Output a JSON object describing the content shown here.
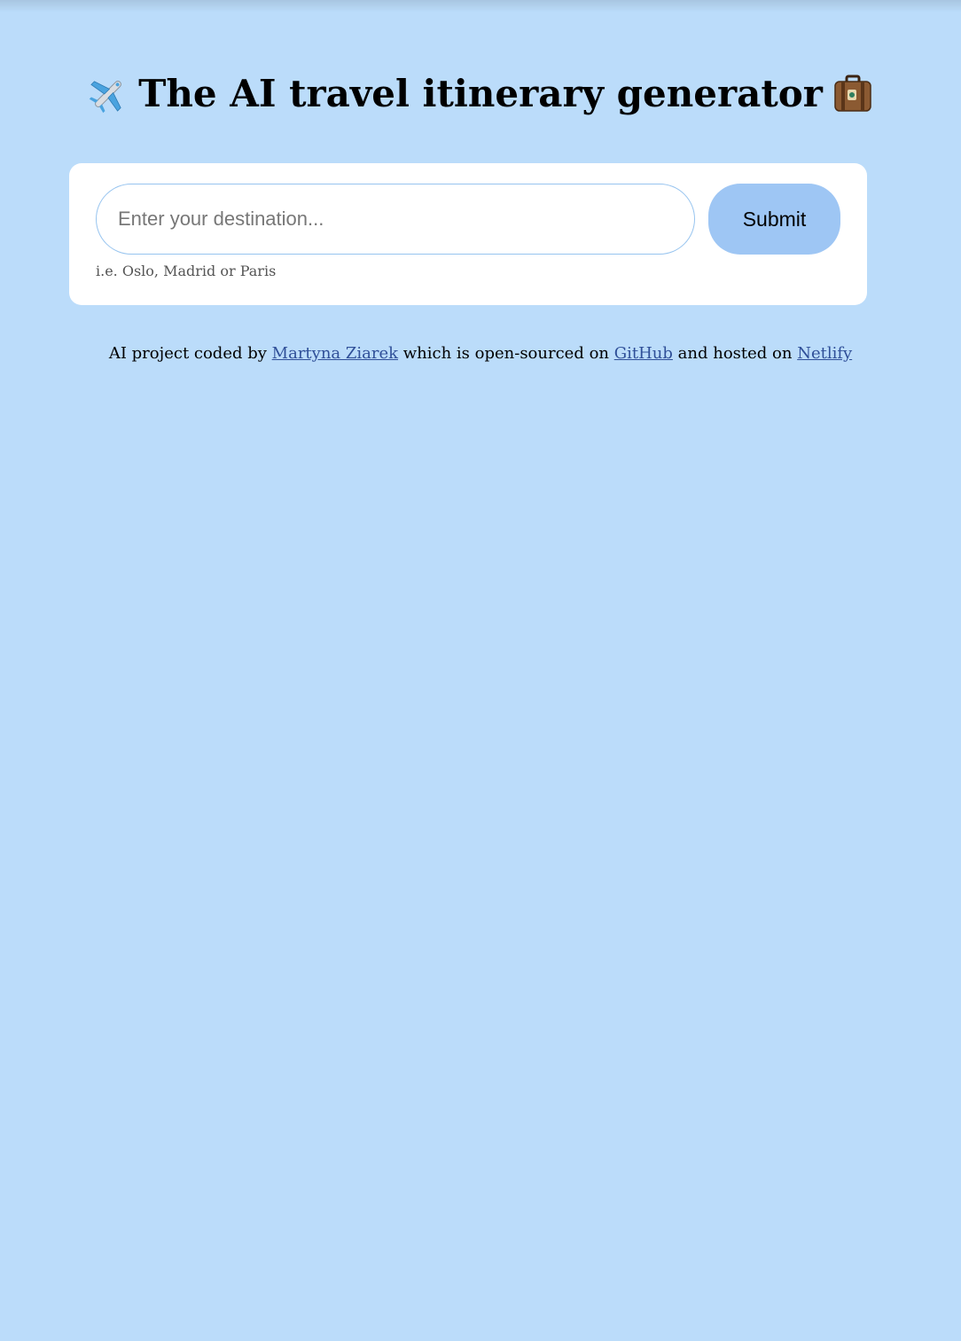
{
  "header": {
    "title": "The AI travel itinerary generator",
    "leading_icon": "airplane-icon",
    "trailing_icon": "luggage-icon"
  },
  "form": {
    "input_placeholder": "Enter your destination...",
    "input_value": "",
    "submit_label": "Submit",
    "hint": "i.e. Oslo, Madrid or Paris"
  },
  "footer": {
    "text_1": "AI project coded by",
    "author_link": "Martyna Ziarek",
    "text_2": "which is open-sourced on",
    "github_link": "GitHub",
    "text_3": "and hosted on",
    "netlify_link": "Netlify"
  },
  "colors": {
    "background": "#bbdcfa",
    "card": "#ffffff",
    "button": "#9ec6f4",
    "input_border": "#97c4ef",
    "link": "#2f4f98"
  }
}
